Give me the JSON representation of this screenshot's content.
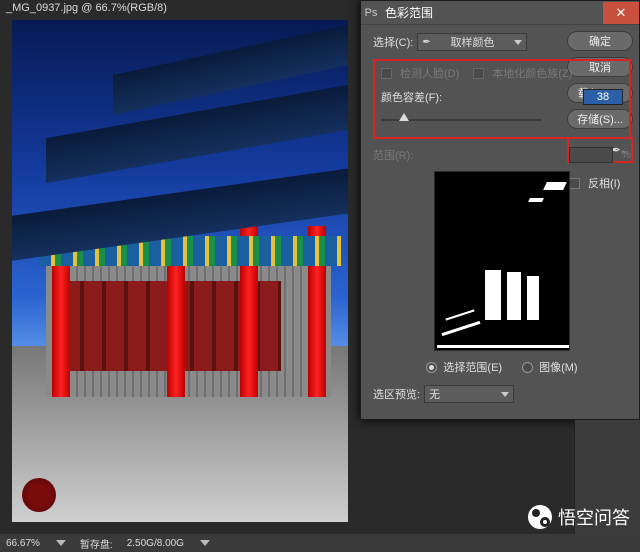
{
  "app": {
    "doc_tab": "_MG_0937.jpg @ 66.7%(RGB/8)",
    "status": {
      "zoom": "66.67%",
      "scratch_label": "暂存盘:",
      "scratch_value": "2.50G/8.00G"
    }
  },
  "dialog": {
    "title": "色彩范围",
    "select_label": "选择(C):",
    "select_value": "取样颜色",
    "detect_faces_label": "检测人脸(D)",
    "localized_label": "本地化颜色族(Z)",
    "fuzziness_label": "颜色容差(F):",
    "fuzziness_value": "38",
    "range_label": "范围(R):",
    "range_unit": "%",
    "radio_selection": "选择范围(E)",
    "radio_image": "图像(M)",
    "preview_label": "选区预览:",
    "preview_value": "无",
    "buttons": {
      "ok": "确定",
      "cancel": "取消",
      "load": "载入(L)...",
      "save": "存储(S)..."
    },
    "eyedroppers": {
      "sample": "eyedropper",
      "add": "eyedropper-plus",
      "subtract": "eyedropper-minus"
    },
    "invert_label": "反相(I)"
  },
  "watermark": "悟空问答"
}
